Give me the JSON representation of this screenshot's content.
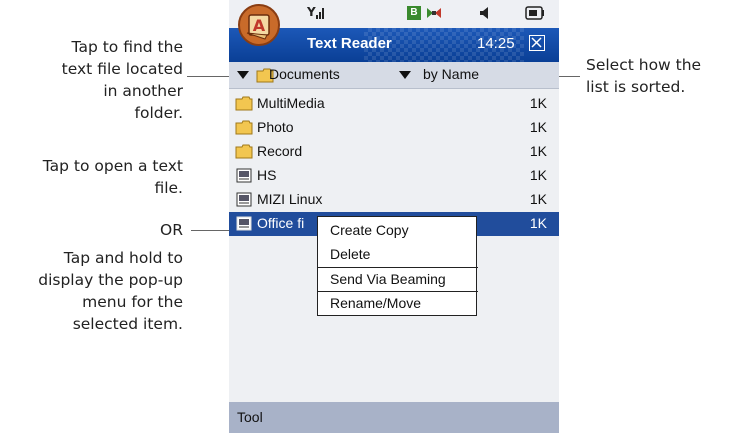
{
  "callouts": {
    "find_text": [
      "Tap to find the",
      "text file located",
      "in another",
      "folder."
    ],
    "open_text": [
      "Tap to open a text",
      "file."
    ],
    "or": "OR",
    "hold_text": [
      "Tap and hold to",
      "display the pop-up",
      "menu for the",
      "selected item."
    ],
    "sort_text": [
      "Select how the",
      "list is sorted."
    ]
  },
  "status_bar": {
    "signal_icon": "signal-icon",
    "indicator_letter": "B",
    "bluetooth_icon": "bowtie-icon",
    "volume_icon": "speaker-icon",
    "battery_icon": "battery-icon"
  },
  "title_bar": {
    "title": "Text Reader",
    "time": "14:25",
    "close_icon": "close-icon"
  },
  "toolbar": {
    "folder_label": "Documents",
    "sort_label": "by Name"
  },
  "files": [
    {
      "name": "MultiMedia",
      "size": "1K",
      "icon": "folder-icon"
    },
    {
      "name": "Photo",
      "size": "1K",
      "icon": "folder-icon"
    },
    {
      "name": "Record",
      "size": "1K",
      "icon": "folder-icon"
    },
    {
      "name": "HS",
      "size": "1K",
      "icon": "text-file-icon"
    },
    {
      "name": "MIZI Linux",
      "size": "1K",
      "icon": "text-file-icon"
    },
    {
      "name": "Office fi",
      "size": "1K",
      "icon": "text-file-icon",
      "selected": true
    }
  ],
  "popup_menu": {
    "items": [
      "Create Copy",
      "Delete",
      "Send Via Beaming",
      "Rename/Move"
    ]
  },
  "bottom_bar": {
    "tool_label": "Tool"
  },
  "colors": {
    "title_bar": "#0a3f96",
    "selected_row": "#214d9c",
    "bottom_bar": "#a8b2c8"
  }
}
